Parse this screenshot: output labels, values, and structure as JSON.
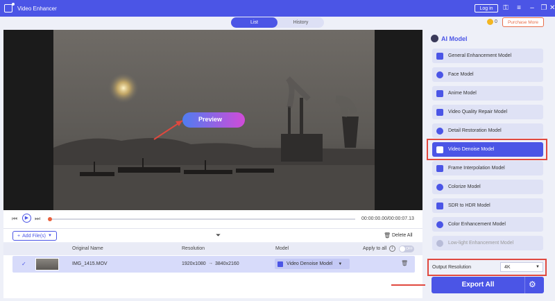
{
  "window": {
    "title": "Video Enhancer",
    "login_label": "Log in"
  },
  "tabs": [
    {
      "label": "List"
    },
    {
      "label": "History"
    }
  ],
  "header": {
    "coin_count": "0",
    "purchase_label": "Purchase More"
  },
  "preview": {
    "button_label": "Preview"
  },
  "player": {
    "time": "00:00:00.00/00:00:07.13"
  },
  "file_bar": {
    "add_label": "Add File(s)",
    "delete_label": "Delete All"
  },
  "table": {
    "headers": {
      "name": "Original Name",
      "resolution": "Resolution",
      "model": "Model",
      "apply_all": "Apply to all",
      "toggle": "OFF"
    },
    "row": {
      "name": "IMG_1415.MOV",
      "res_from": "1920x1080",
      "res_to": "3840x2160",
      "model": "Video Denoise Model"
    }
  },
  "sidebar": {
    "title": "AI Model",
    "models": [
      {
        "label": "General Enhancement Model"
      },
      {
        "label": "Face Model"
      },
      {
        "label": "Anime Model"
      },
      {
        "label": "Video Quality Repair Model"
      },
      {
        "label": "Detail Restoration Model"
      },
      {
        "label": "Video Denoise Model"
      },
      {
        "label": "Frame Interpolation Model"
      },
      {
        "label": "Colorize Model"
      },
      {
        "label": "SDR to HDR Model"
      },
      {
        "label": "Color Enhancement Model"
      },
      {
        "label": "Low-light Enhancement Model"
      }
    ],
    "output_label": "Output Resolution",
    "output_value": "4K",
    "export_label": "Export All"
  },
  "colors": {
    "accent": "#4b55e6",
    "highlight": "#e0483e",
    "progress": "#e9603c"
  }
}
